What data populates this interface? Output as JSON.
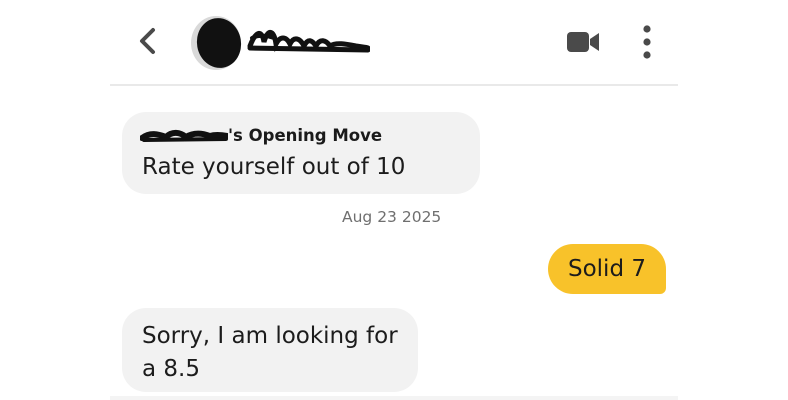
{
  "header": {
    "back_icon": "chevron-left-icon",
    "avatar": "profile-avatar",
    "video_icon": "video-camera-icon",
    "more_icon": "more-vertical-icon"
  },
  "messages": {
    "opening_move": {
      "label_suffix": "'s Opening Move",
      "text": "Rate yourself out of 10"
    },
    "date": "Aug 23 2025",
    "sent": {
      "text": "Solid 7"
    },
    "received": {
      "line1": "Sorry, I am looking for",
      "line2": "a 8.5"
    }
  },
  "colors": {
    "sent_bubble": "#f8c22a",
    "received_bubble": "#f2f2f2",
    "icon": "#4a4a4a"
  }
}
